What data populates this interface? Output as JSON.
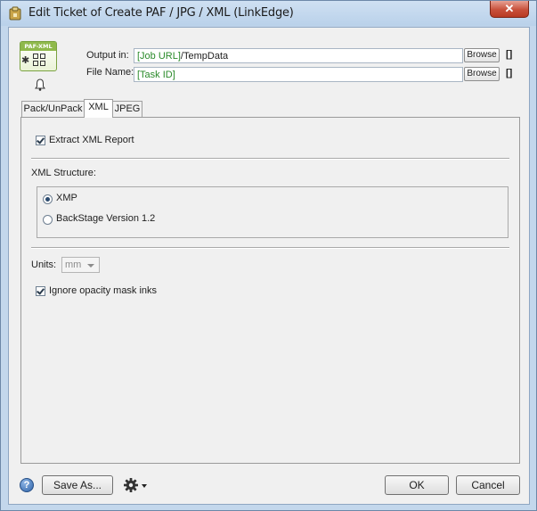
{
  "window": {
    "title": "Edit Ticket of Create PAF / JPG / XML (LinkEdge)"
  },
  "header": {
    "icon_label": "PAF-XML",
    "output_label": "Output in:",
    "output_value_token": "[Job URL]",
    "output_value_rest": "/TempData",
    "filename_label": "File Name:",
    "filename_value_token": "[Task ID]",
    "browse_label": "Browse",
    "bracket_label": "[]"
  },
  "tabs": [
    {
      "label": "Pack/UnPack",
      "active": false
    },
    {
      "label": "XML",
      "active": true
    },
    {
      "label": "JPEG",
      "active": false
    }
  ],
  "xml_tab": {
    "extract_report": {
      "label": "Extract XML Report",
      "checked": true
    },
    "structure_label": "XML Structure:",
    "structure_options": [
      {
        "label": "XMP",
        "selected": true
      },
      {
        "label": "BackStage Version 1.2",
        "selected": false
      }
    ],
    "units_label": "Units:",
    "units_value": "mm",
    "ignore_opacity": {
      "label": "Ignore opacity mask inks",
      "checked": true
    }
  },
  "footer": {
    "help_label": "?",
    "save_as_label": "Save As...",
    "ok_label": "OK",
    "cancel_label": "Cancel"
  },
  "colors": {
    "token_green": "#2a8a2a",
    "close_red": "#c8503a",
    "title_gradient": "#b9d1ea"
  }
}
